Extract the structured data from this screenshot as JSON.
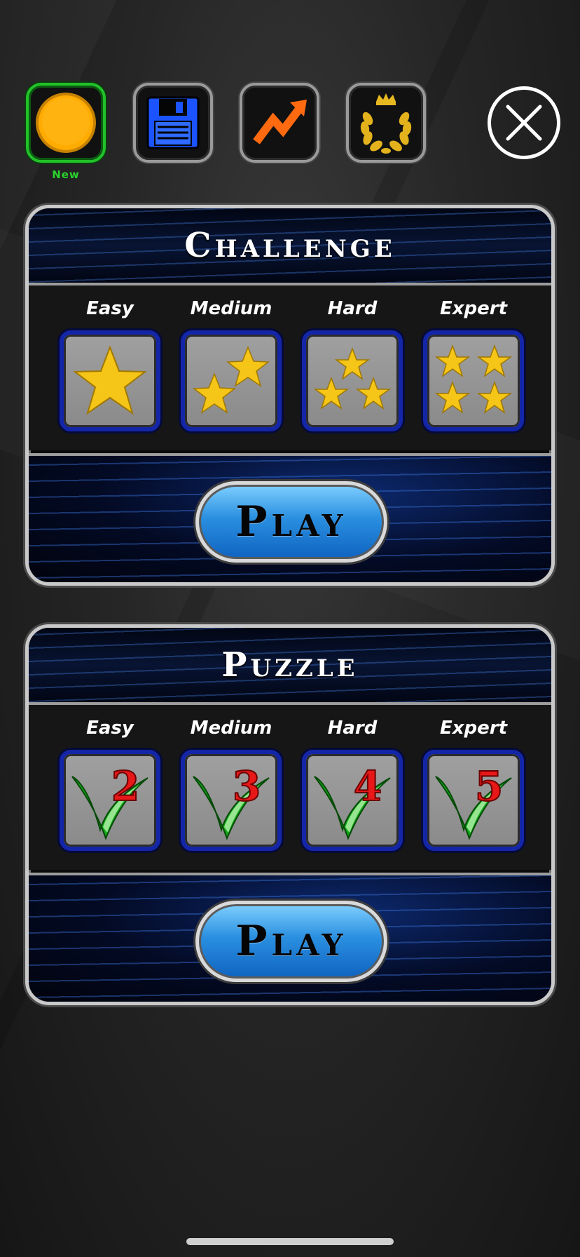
{
  "toolbar": {
    "new_label": "New",
    "buttons": [
      {
        "icon": "coin-icon",
        "active": true
      },
      {
        "icon": "save-disk-icon",
        "active": false
      },
      {
        "icon": "stats-arrow-icon",
        "active": false
      },
      {
        "icon": "laurel-crown-icon",
        "active": false
      }
    ],
    "close_icon": "close-icon"
  },
  "challenge": {
    "title": "Challenge",
    "levels": [
      {
        "label": "Easy",
        "stars": 1
      },
      {
        "label": "Medium",
        "stars": 2
      },
      {
        "label": "Hard",
        "stars": 3
      },
      {
        "label": "Expert",
        "stars": 4
      }
    ],
    "play_label": "Play"
  },
  "puzzle": {
    "title": "Puzzle",
    "levels": [
      {
        "label": "Easy",
        "number": "2"
      },
      {
        "label": "Medium",
        "number": "3"
      },
      {
        "label": "Hard",
        "number": "4"
      },
      {
        "label": "Expert",
        "number": "5"
      }
    ],
    "play_label": "Play"
  },
  "colors": {
    "active_border": "#22c12a",
    "tile_border": "#1426a8",
    "play_button": "#2a8fe0",
    "number_red": "#e81818",
    "check_green": "#12a818",
    "star_gold": "#f5c518"
  }
}
